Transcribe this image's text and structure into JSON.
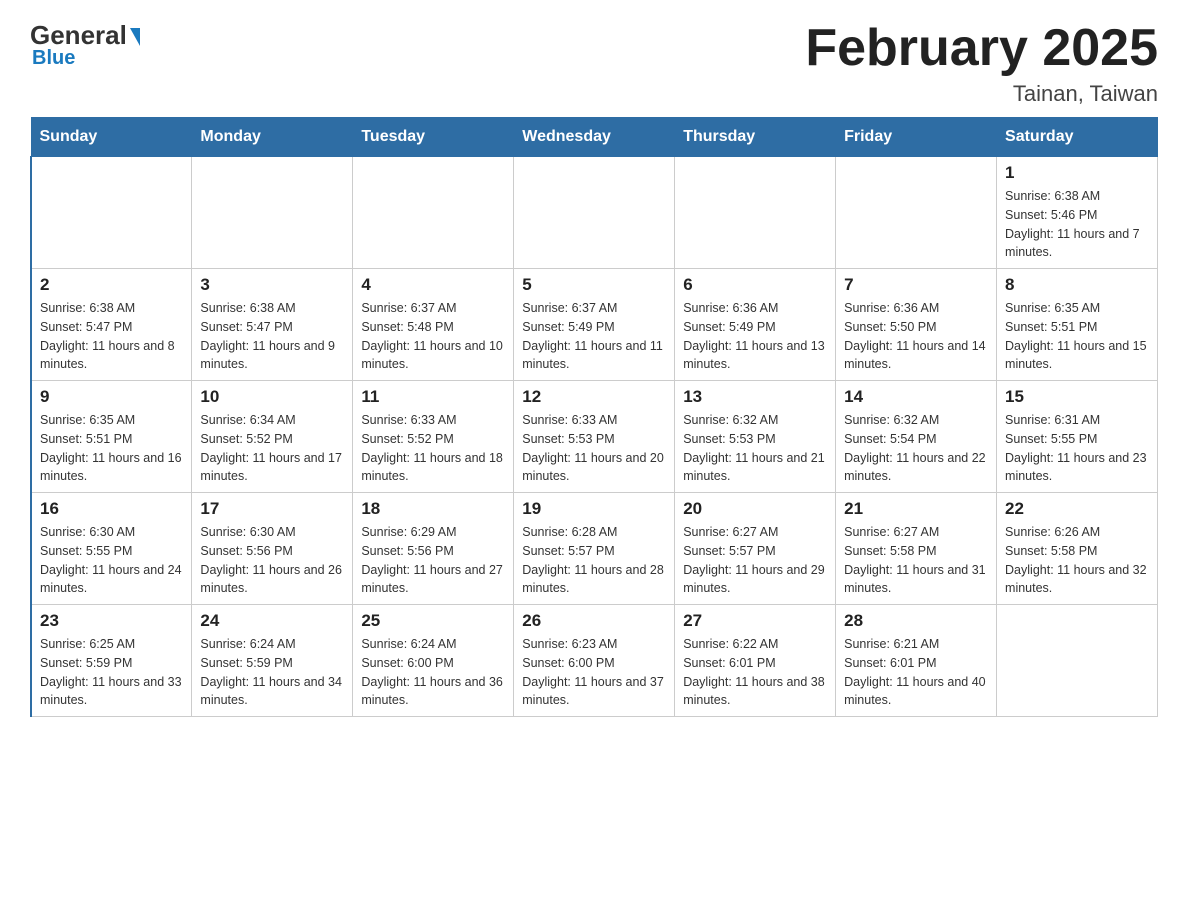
{
  "logo": {
    "general": "General",
    "arrow": "",
    "blue": "Blue"
  },
  "header": {
    "title": "February 2025",
    "subtitle": "Tainan, Taiwan"
  },
  "days_of_week": [
    "Sunday",
    "Monday",
    "Tuesday",
    "Wednesday",
    "Thursday",
    "Friday",
    "Saturday"
  ],
  "weeks": [
    [
      {
        "day": "",
        "info": ""
      },
      {
        "day": "",
        "info": ""
      },
      {
        "day": "",
        "info": ""
      },
      {
        "day": "",
        "info": ""
      },
      {
        "day": "",
        "info": ""
      },
      {
        "day": "",
        "info": ""
      },
      {
        "day": "1",
        "info": "Sunrise: 6:38 AM\nSunset: 5:46 PM\nDaylight: 11 hours and 7 minutes."
      }
    ],
    [
      {
        "day": "2",
        "info": "Sunrise: 6:38 AM\nSunset: 5:47 PM\nDaylight: 11 hours and 8 minutes."
      },
      {
        "day": "3",
        "info": "Sunrise: 6:38 AM\nSunset: 5:47 PM\nDaylight: 11 hours and 9 minutes."
      },
      {
        "day": "4",
        "info": "Sunrise: 6:37 AM\nSunset: 5:48 PM\nDaylight: 11 hours and 10 minutes."
      },
      {
        "day": "5",
        "info": "Sunrise: 6:37 AM\nSunset: 5:49 PM\nDaylight: 11 hours and 11 minutes."
      },
      {
        "day": "6",
        "info": "Sunrise: 6:36 AM\nSunset: 5:49 PM\nDaylight: 11 hours and 13 minutes."
      },
      {
        "day": "7",
        "info": "Sunrise: 6:36 AM\nSunset: 5:50 PM\nDaylight: 11 hours and 14 minutes."
      },
      {
        "day": "8",
        "info": "Sunrise: 6:35 AM\nSunset: 5:51 PM\nDaylight: 11 hours and 15 minutes."
      }
    ],
    [
      {
        "day": "9",
        "info": "Sunrise: 6:35 AM\nSunset: 5:51 PM\nDaylight: 11 hours and 16 minutes."
      },
      {
        "day": "10",
        "info": "Sunrise: 6:34 AM\nSunset: 5:52 PM\nDaylight: 11 hours and 17 minutes."
      },
      {
        "day": "11",
        "info": "Sunrise: 6:33 AM\nSunset: 5:52 PM\nDaylight: 11 hours and 18 minutes."
      },
      {
        "day": "12",
        "info": "Sunrise: 6:33 AM\nSunset: 5:53 PM\nDaylight: 11 hours and 20 minutes."
      },
      {
        "day": "13",
        "info": "Sunrise: 6:32 AM\nSunset: 5:53 PM\nDaylight: 11 hours and 21 minutes."
      },
      {
        "day": "14",
        "info": "Sunrise: 6:32 AM\nSunset: 5:54 PM\nDaylight: 11 hours and 22 minutes."
      },
      {
        "day": "15",
        "info": "Sunrise: 6:31 AM\nSunset: 5:55 PM\nDaylight: 11 hours and 23 minutes."
      }
    ],
    [
      {
        "day": "16",
        "info": "Sunrise: 6:30 AM\nSunset: 5:55 PM\nDaylight: 11 hours and 24 minutes."
      },
      {
        "day": "17",
        "info": "Sunrise: 6:30 AM\nSunset: 5:56 PM\nDaylight: 11 hours and 26 minutes."
      },
      {
        "day": "18",
        "info": "Sunrise: 6:29 AM\nSunset: 5:56 PM\nDaylight: 11 hours and 27 minutes."
      },
      {
        "day": "19",
        "info": "Sunrise: 6:28 AM\nSunset: 5:57 PM\nDaylight: 11 hours and 28 minutes."
      },
      {
        "day": "20",
        "info": "Sunrise: 6:27 AM\nSunset: 5:57 PM\nDaylight: 11 hours and 29 minutes."
      },
      {
        "day": "21",
        "info": "Sunrise: 6:27 AM\nSunset: 5:58 PM\nDaylight: 11 hours and 31 minutes."
      },
      {
        "day": "22",
        "info": "Sunrise: 6:26 AM\nSunset: 5:58 PM\nDaylight: 11 hours and 32 minutes."
      }
    ],
    [
      {
        "day": "23",
        "info": "Sunrise: 6:25 AM\nSunset: 5:59 PM\nDaylight: 11 hours and 33 minutes."
      },
      {
        "day": "24",
        "info": "Sunrise: 6:24 AM\nSunset: 5:59 PM\nDaylight: 11 hours and 34 minutes."
      },
      {
        "day": "25",
        "info": "Sunrise: 6:24 AM\nSunset: 6:00 PM\nDaylight: 11 hours and 36 minutes."
      },
      {
        "day": "26",
        "info": "Sunrise: 6:23 AM\nSunset: 6:00 PM\nDaylight: 11 hours and 37 minutes."
      },
      {
        "day": "27",
        "info": "Sunrise: 6:22 AM\nSunset: 6:01 PM\nDaylight: 11 hours and 38 minutes."
      },
      {
        "day": "28",
        "info": "Sunrise: 6:21 AM\nSunset: 6:01 PM\nDaylight: 11 hours and 40 minutes."
      },
      {
        "day": "",
        "info": ""
      }
    ]
  ]
}
